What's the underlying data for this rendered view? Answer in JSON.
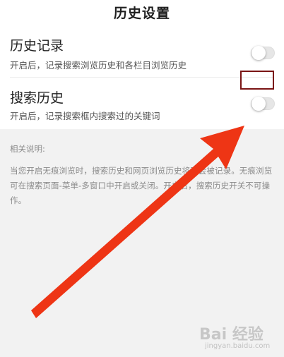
{
  "header": {
    "title": "历史设置"
  },
  "settings": {
    "items": [
      {
        "title": "历史记录",
        "description": "开启后，记录搜索浏览历史和各栏目浏览历史",
        "enabled": false
      },
      {
        "title": "搜索历史",
        "description": "开启后，记录搜索框内搜索过的关键词",
        "enabled": false
      }
    ]
  },
  "notes": {
    "title": "相关说明:",
    "body": "当您开启无痕浏览时，搜索历史和网页浏览历史将不会被记录。无痕浏览可在搜索页面-菜单-多窗口中开启或关闭。开启后，搜索历史开关不可操作。"
  },
  "annotation": {
    "arrow_color": "#ee3515",
    "box_color": "#7a1414"
  },
  "watermark": {
    "logo": "Bai 经验",
    "subtitle": "jingyan.baidu.com"
  }
}
